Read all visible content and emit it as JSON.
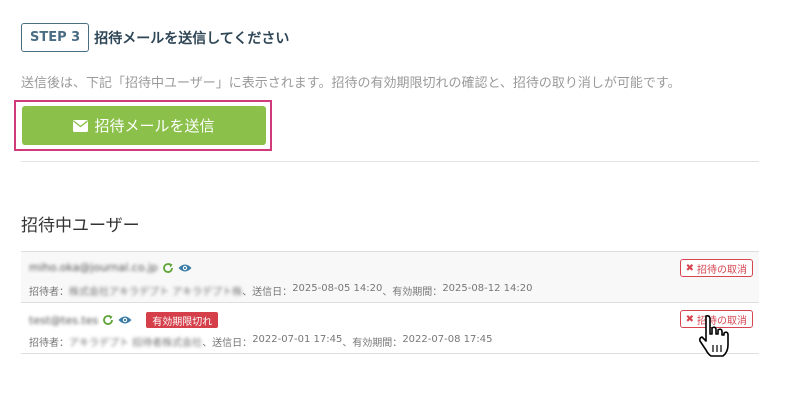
{
  "step": {
    "badge": "STEP 3",
    "title": "招待メールを送信してください"
  },
  "description": "送信後は、下記「招待中ユーザー」に表示されます。招待の有効期限切れの確認と、招待の取り消しが可能です。",
  "send_button": {
    "label": "招待メールを送信",
    "icon": "envelope-icon"
  },
  "section_title": "招待中ユーザー",
  "invites": [
    {
      "email": "miho.oka@journal.co.jp",
      "inviter_label": "招待者：",
      "inviter": "株式会社アキラデプト アキラデプト株",
      "sent_label": "、送信日：",
      "sent": "2025-08-05 14:20",
      "expiry_label": "、有効期間：",
      "expiry": "2025-08-12 14:20",
      "cancel_label": "招待の取消"
    },
    {
      "email": "test@tes.tes",
      "expired_badge": "有効期限切れ",
      "inviter_label": "招待者：",
      "inviter": "アキラデプト 招待者株式会社",
      "sent_label": "、送信日：",
      "sent": "2022-07-01 17:45",
      "expiry_label": "、有効期間：",
      "expiry": "2022-07-08 17:45",
      "cancel_label": "招待の取消"
    }
  ],
  "colors": {
    "accent_green": "#8bc14b",
    "highlight_pink": "#d0397a",
    "danger_red": "#d43f4a",
    "badge_blue": "#4a6d83"
  }
}
